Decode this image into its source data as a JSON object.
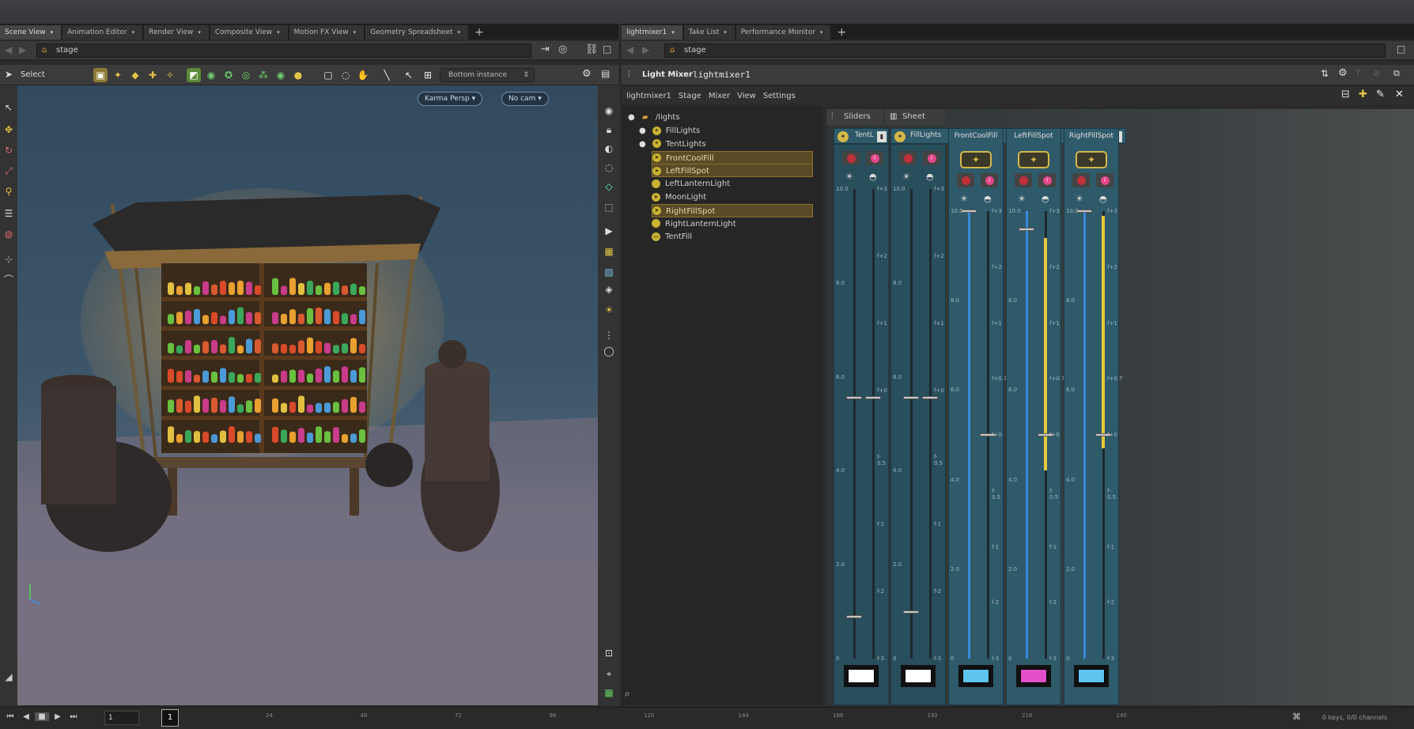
{
  "left_tabs": [
    {
      "label": "Scene View",
      "active": true
    },
    {
      "label": "Animation Editor"
    },
    {
      "label": "Render View"
    },
    {
      "label": "Composite View"
    },
    {
      "label": "Motion FX View"
    },
    {
      "label": "Geometry Spreadsheet"
    }
  ],
  "right_tabs": [
    {
      "label": "lightmixer1",
      "active": true
    },
    {
      "label": "Take List"
    },
    {
      "label": "Performance Monitor"
    }
  ],
  "left_path": "stage",
  "right_path": "stage",
  "viewport_toolbar": {
    "select_label": "Select",
    "instance_dropdown": "Bottom instance"
  },
  "viewport": {
    "camera_pill": "Karma Persp",
    "cam_pill": "No cam"
  },
  "lightmixer_header": {
    "tab_label": "Light Mixer",
    "node_name": "lightmixer1"
  },
  "menu": [
    "lightmixer1",
    "Stage",
    "Mixer",
    "View",
    "Settings"
  ],
  "tree": {
    "root": "/lights",
    "items": [
      {
        "label": "FillLights",
        "indent": 1,
        "selected": false,
        "icon": "group-icon"
      },
      {
        "label": "TentLights",
        "indent": 1,
        "selected": false,
        "icon": "group-icon"
      },
      {
        "label": "FrontCoolFill",
        "indent": 2,
        "selected": true,
        "icon": "spotlight-icon"
      },
      {
        "label": "LeftFillSpot",
        "indent": 2,
        "selected": true,
        "icon": "spotlight-icon"
      },
      {
        "label": "LeftLanternLight",
        "indent": 2,
        "selected": false,
        "icon": "bulb-icon"
      },
      {
        "label": "MoonLight",
        "indent": 2,
        "selected": false,
        "icon": "spotlight-icon"
      },
      {
        "label": "RightFillSpot",
        "indent": 2,
        "selected": true,
        "icon": "spotlight-icon"
      },
      {
        "label": "RightLanternLight",
        "indent": 2,
        "selected": false,
        "icon": "bulb-icon"
      },
      {
        "label": "TentFill",
        "indent": 2,
        "selected": false,
        "icon": "arealight-icon"
      }
    ]
  },
  "mixer_tabs": [
    "Sliders",
    "Sheet"
  ],
  "groups": [
    {
      "label": "TentL"
    },
    {
      "label": "FillLights"
    }
  ],
  "strips": [
    {
      "name": "",
      "kind": "group",
      "swatch": "#ffffff",
      "intensity_frac": 0.555,
      "intensity_labels": [
        "10.0",
        "8.0",
        "6.0",
        "4.0",
        "2.0",
        "0"
      ],
      "exposure_labels": [
        "f+3",
        "f+2",
        "f+1",
        "f+0",
        "f-0.5",
        "f-1",
        "f-2",
        "f-3"
      ],
      "level": 0.09
    },
    {
      "name": "",
      "kind": "group",
      "swatch": "#ffffff",
      "intensity_frac": 0.555,
      "intensity_labels": [
        "10.0",
        "8.0",
        "6.0",
        "4.0",
        "2.0",
        "0"
      ],
      "exposure_labels": [
        "f+3",
        "f+2",
        "f+1",
        "f+0",
        "f-0.5",
        "f-1",
        "f-2",
        "f-3"
      ],
      "level": 0.1
    },
    {
      "name": "FrontCoolFill",
      "kind": "light",
      "swatch": "#5ec4f0",
      "intensity_frac": 1.0,
      "intensity_labels": [
        "10.0",
        "8.0",
        "6.0",
        "4.0",
        "2.0",
        "0"
      ],
      "exposure_labels": [
        "f+3",
        "f+2",
        "f+1",
        "f+0.7",
        "f+0",
        "f-0.5",
        "f-1",
        "f-2",
        "f-3"
      ],
      "level": 0.5
    },
    {
      "name": "LeftFillSpot",
      "kind": "light",
      "swatch": "#e24fc8",
      "intensity_frac": 0.96,
      "intensity_labels": [
        "10.0",
        "8.0",
        "6.0",
        "4.0",
        "2.0",
        "0"
      ],
      "exposure_labels": [
        "f+3",
        "f+2",
        "f+1",
        "f+0.7",
        "f+0",
        "f-0.5",
        "f-1",
        "f-2",
        "f-3"
      ],
      "level": 0.94
    },
    {
      "name": "RightFillSpot",
      "kind": "light",
      "swatch": "#5ec4f0",
      "intensity_frac": 1.0,
      "intensity_labels": [
        "10.0",
        "8.0",
        "6.0",
        "4.0",
        "2.0",
        "0"
      ],
      "exposure_labels": [
        "f+3",
        "f+2",
        "f+1",
        "f+0.7",
        "f+0",
        "f-0.5",
        "f-1",
        "f-2",
        "f-3"
      ],
      "level": 0.99
    }
  ],
  "timeline": {
    "current_frame": "1",
    "ticks": [
      "24",
      "48",
      "72",
      "96",
      "120",
      "144",
      "168",
      "192",
      "216",
      "240"
    ],
    "status": "0 keys, 0/0 channels"
  }
}
